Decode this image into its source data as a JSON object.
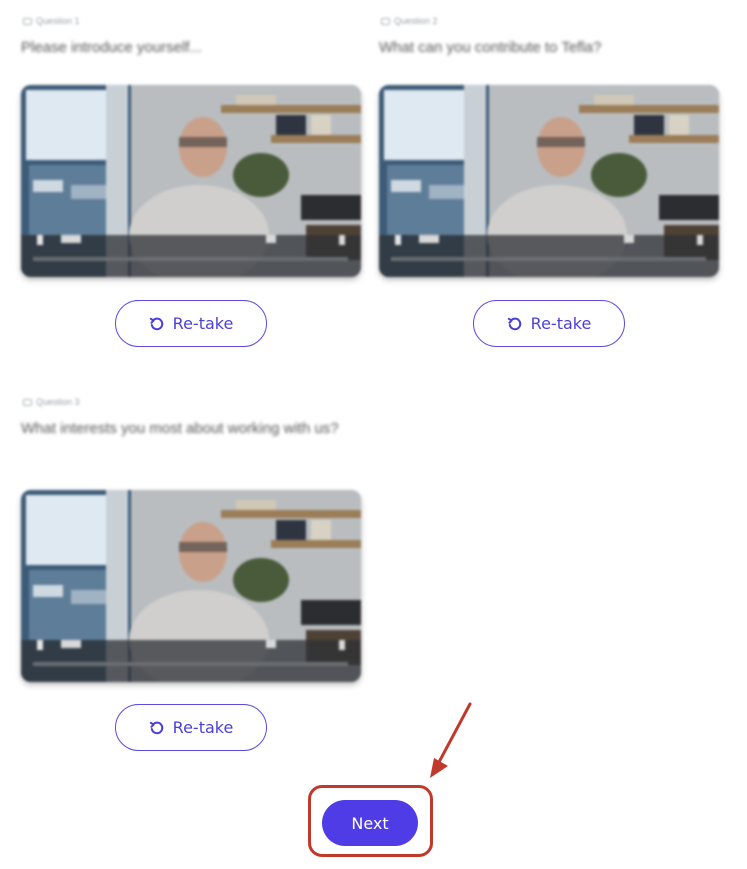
{
  "questions": [
    {
      "meta": "Question 1",
      "text": "Please introduce yourself...",
      "video_icon": "video-thumbnail",
      "retake_label": "Re-take"
    },
    {
      "meta": "Question 2",
      "text": "What can you contribute to Tefla?",
      "video_icon": "video-thumbnail",
      "retake_label": "Re-take"
    },
    {
      "meta": "Question 3",
      "text": "What interests you most about working with us?",
      "video_icon": "video-thumbnail",
      "retake_label": "Re-take"
    }
  ],
  "next_label": "Next",
  "colors": {
    "accent": "#4f3ce6",
    "outline": "#5a4be6",
    "highlight": "#c0392b"
  },
  "icons": {
    "retake": "rotate-ccw-icon",
    "question_meta": "camera-icon",
    "annotation": "arrow-icon"
  }
}
